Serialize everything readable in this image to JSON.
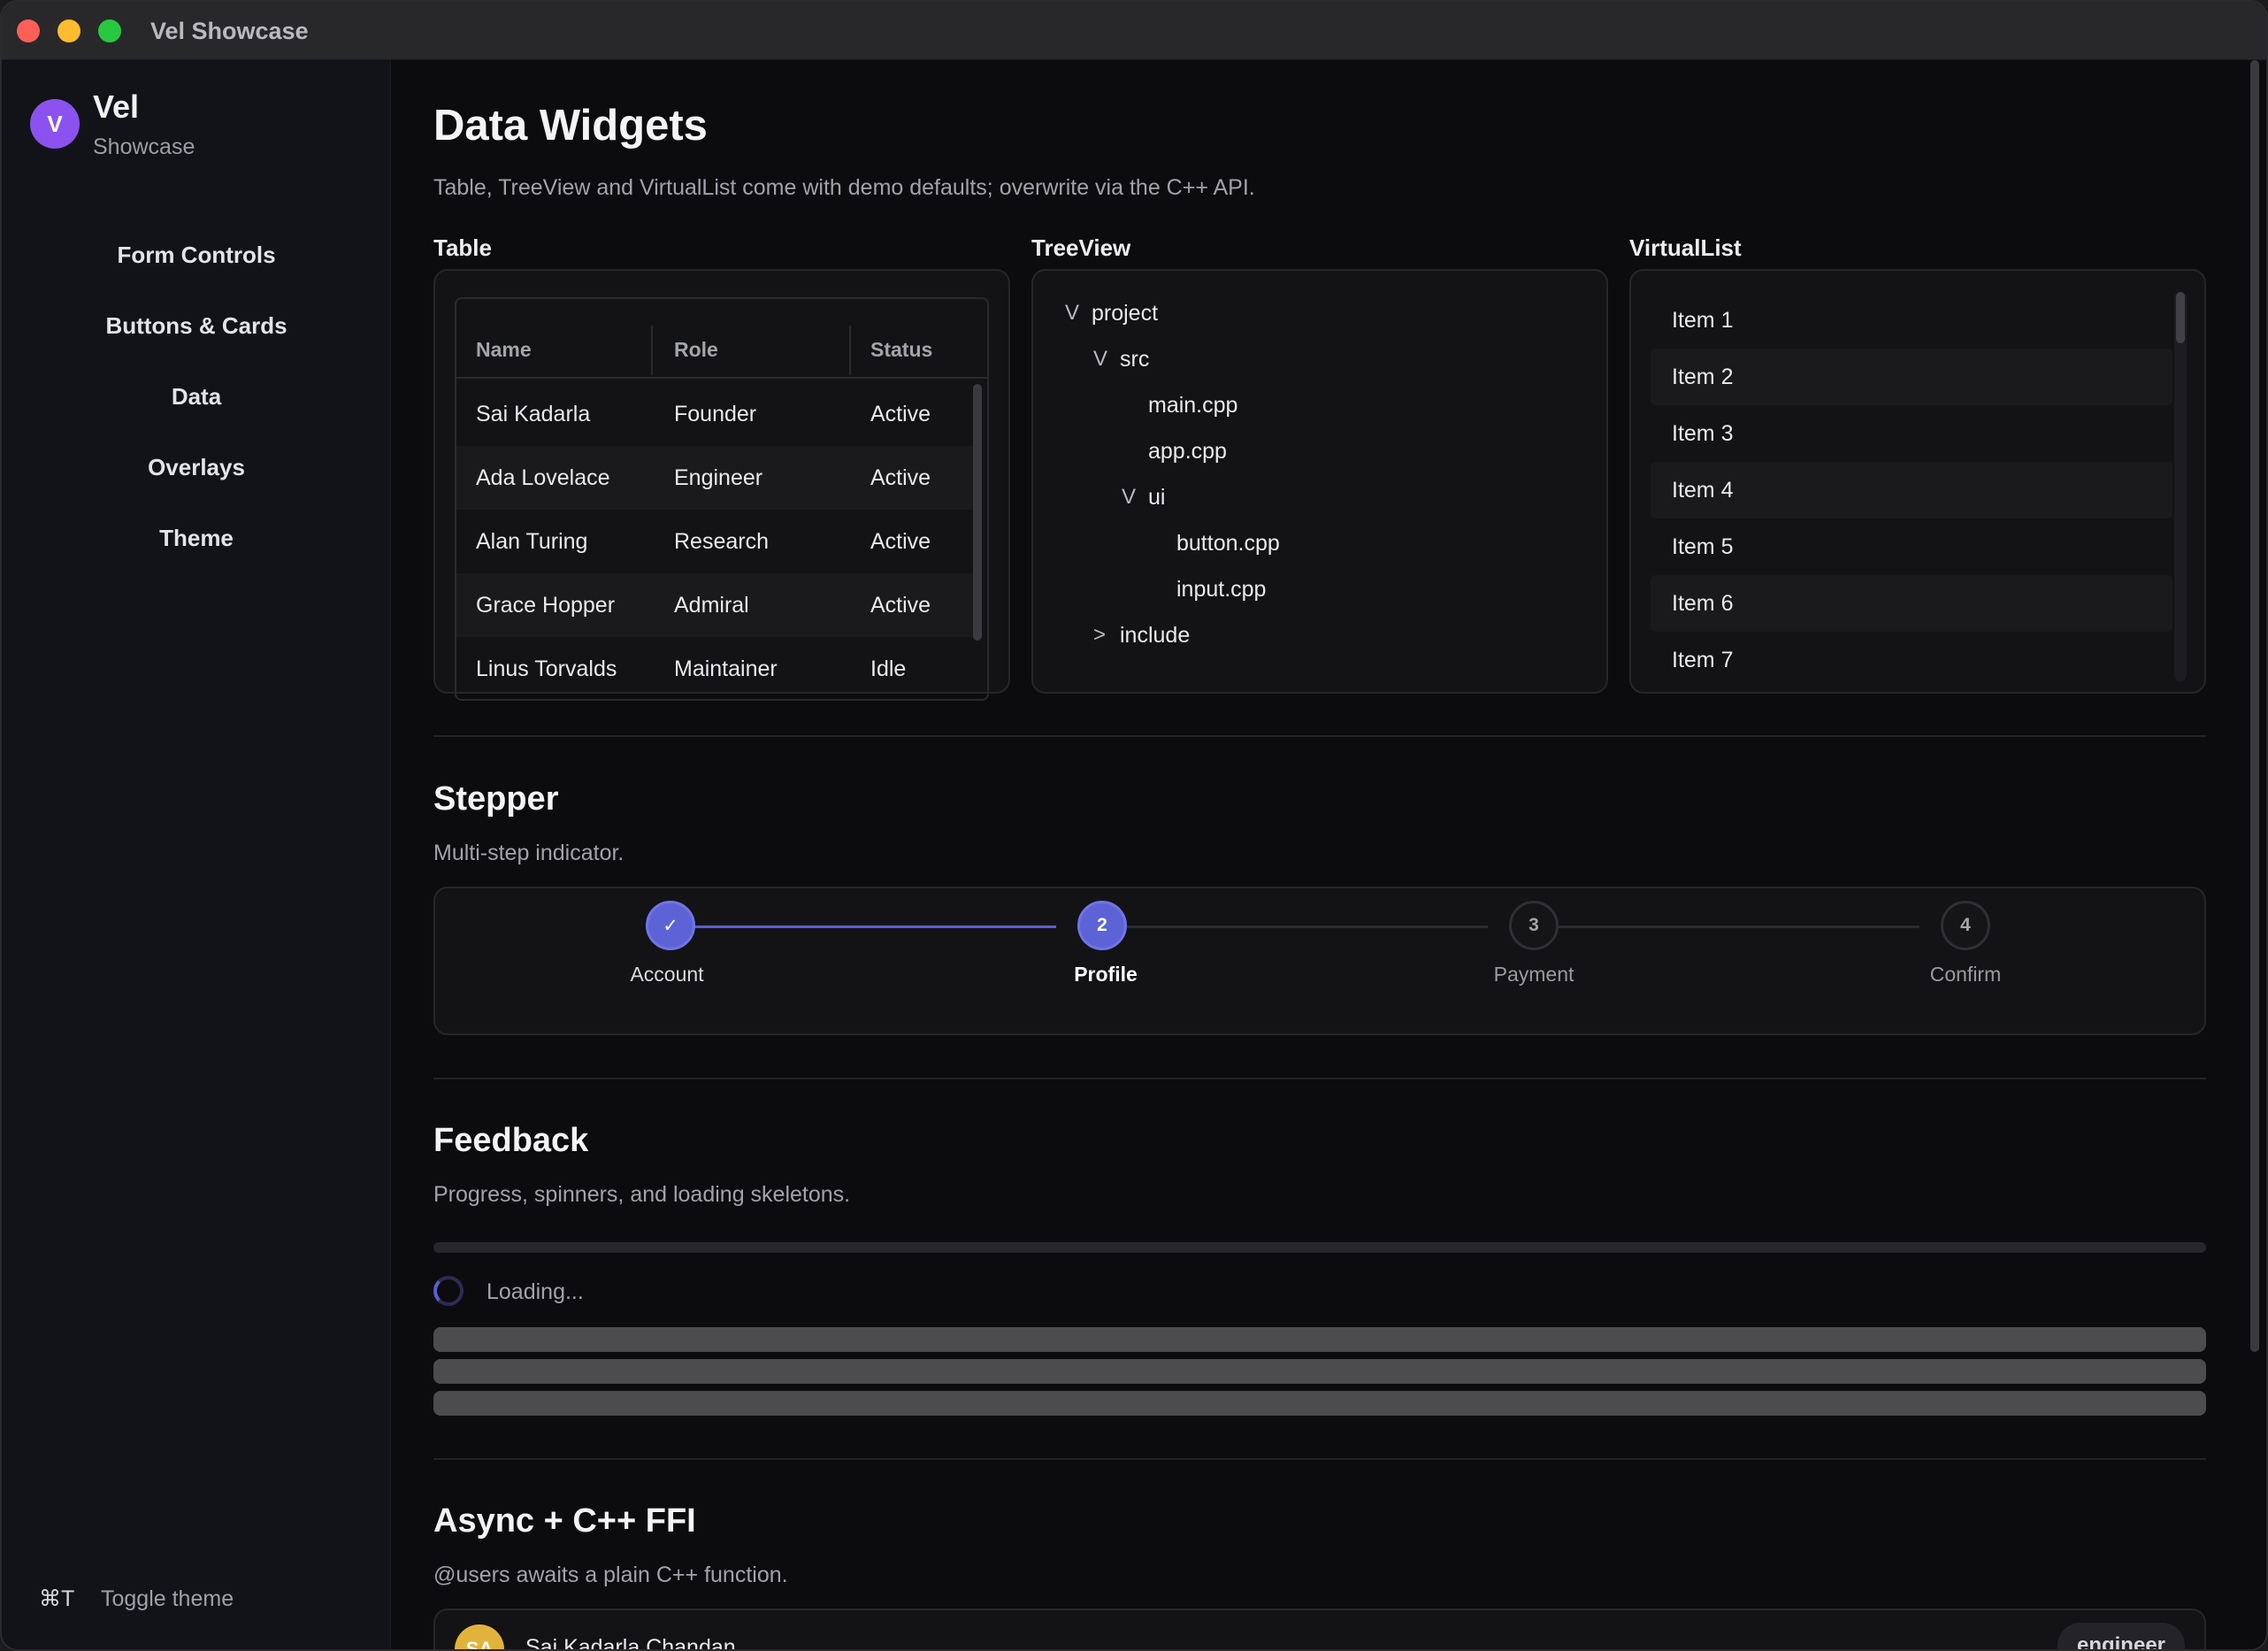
{
  "window": {
    "title": "Vel Showcase"
  },
  "sidebar": {
    "avatar_letter": "V",
    "brand": "Vel",
    "brand_sub": "Showcase",
    "items": [
      {
        "label": "Form Controls"
      },
      {
        "label": "Buttons & Cards"
      },
      {
        "label": "Data"
      },
      {
        "label": "Overlays"
      },
      {
        "label": "Theme"
      }
    ],
    "shortcut": "⌘T",
    "toggle_label": "Toggle theme"
  },
  "data_widgets": {
    "title": "Data Widgets",
    "description": "Table, TreeView and VirtualList come with demo defaults; overwrite via the C++ API.",
    "table": {
      "label": "Table",
      "columns": [
        "Name",
        "Role",
        "Status"
      ],
      "rows": [
        [
          "Sai Kadarla",
          "Founder",
          "Active"
        ],
        [
          "Ada Lovelace",
          "Engineer",
          "Active"
        ],
        [
          "Alan Turing",
          "Research",
          "Active"
        ],
        [
          "Grace Hopper",
          "Admiral",
          "Active"
        ],
        [
          "Linus Torvalds",
          "Maintainer",
          "Idle"
        ]
      ]
    },
    "treeview": {
      "label": "TreeView",
      "nodes": [
        {
          "label": "project",
          "chevron": "V"
        },
        {
          "label": "src",
          "chevron": "V"
        },
        {
          "label": "main.cpp",
          "chevron": ""
        },
        {
          "label": "app.cpp",
          "chevron": ""
        },
        {
          "label": "ui",
          "chevron": "V"
        },
        {
          "label": "button.cpp",
          "chevron": ""
        },
        {
          "label": "input.cpp",
          "chevron": ""
        },
        {
          "label": "include",
          "chevron": ">"
        }
      ]
    },
    "virtuallist": {
      "label": "VirtualList",
      "items": [
        "Item 1",
        "Item 2",
        "Item 3",
        "Item 4",
        "Item 5",
        "Item 6",
        "Item 7"
      ]
    }
  },
  "stepper": {
    "title": "Stepper",
    "description": "Multi-step indicator.",
    "steps": [
      {
        "number": "✓",
        "label": "Account"
      },
      {
        "number": "2",
        "label": "Profile"
      },
      {
        "number": "3",
        "label": "Payment"
      },
      {
        "number": "4",
        "label": "Confirm"
      }
    ],
    "current_step": 2
  },
  "feedback": {
    "title": "Feedback",
    "description": "Progress, spinners, and loading skeletons.",
    "loading_text": "Loading...",
    "progress": 0
  },
  "async": {
    "title": "Async + C++ FFI",
    "description": "@users awaits a plain C++ function.",
    "user": {
      "initials": "SA",
      "name": "Sai Kadarla Chandan",
      "tag": "engineer"
    }
  },
  "colors": {
    "accent": "#5d63d6",
    "brand_avatar": "#8b52f0",
    "user_avatar": "#e2b33b"
  }
}
